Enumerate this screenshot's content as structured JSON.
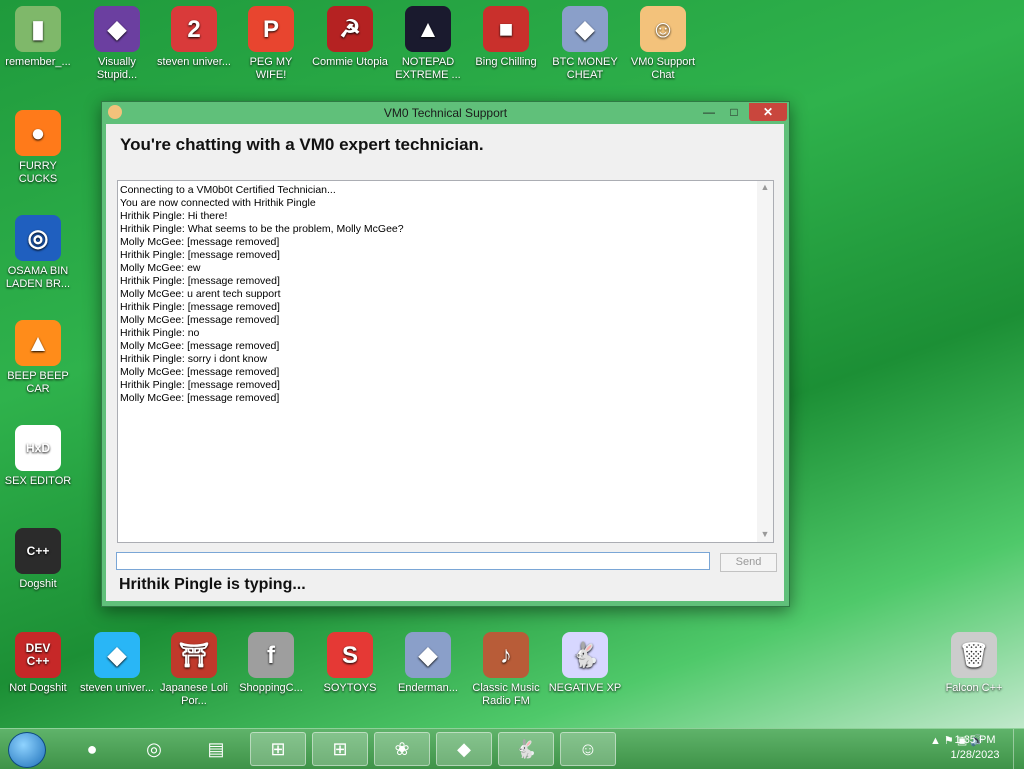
{
  "desktop_icons_top": [
    {
      "label": "remember_...",
      "color": "#7fb86a",
      "glyph": "▮"
    },
    {
      "label": "Visually Stupid...",
      "color": "#6b3fa0",
      "glyph": "◆"
    },
    {
      "label": "steven univer...",
      "color": "#d93a3a",
      "glyph": "2"
    },
    {
      "label": "PEG MY WIFE!",
      "color": "#e8452f",
      "glyph": "P"
    },
    {
      "label": "Commie Utopia",
      "color": "#b52222",
      "glyph": "☭"
    },
    {
      "label": "NOTEPAD EXTREME ...",
      "color": "#1a1a2e",
      "glyph": "▲"
    },
    {
      "label": "Bing Chilling",
      "color": "#c9302c",
      "glyph": "■"
    },
    {
      "label": "BTC MONEY CHEAT",
      "color": "#8a9fc9",
      "glyph": "◆"
    },
    {
      "label": "VM0 Support Chat",
      "color": "#f3c27b",
      "glyph": "☺"
    }
  ],
  "desktop_icons_left": [
    {
      "label": "FURRY CUCKS",
      "color": "#ff7a1a",
      "glyph": "●"
    },
    {
      "label": "OSAMA BIN LADEN BR...",
      "color": "#1f5fbf",
      "glyph": "◎"
    },
    {
      "label": "BEEP BEEP CAR",
      "color": "#ff8c1a",
      "glyph": "▲"
    },
    {
      "label": "SEX EDITOR",
      "color": "#ffffff",
      "glyph": "HxD"
    },
    {
      "label": "Dogshit",
      "color": "#2b2b2b",
      "glyph": "C++"
    }
  ],
  "desktop_icons_bottom": [
    {
      "label": "Not Dogshit",
      "color": "#c62828",
      "glyph": "DEV C++"
    },
    {
      "label": "steven univer...",
      "color": "#29b6f6",
      "glyph": "◆"
    },
    {
      "label": "Japanese Loli Por...",
      "color": "#c0392b",
      "glyph": "⛩"
    },
    {
      "label": "ShoppingC...",
      "color": "#9e9e9e",
      "glyph": "f"
    },
    {
      "label": "SOYTOYS",
      "color": "#e53935",
      "glyph": "S"
    },
    {
      "label": "Enderman...",
      "color": "#8a9fc9",
      "glyph": "◆"
    },
    {
      "label": "Classic Music Radio FM",
      "color": "#b85c38",
      "glyph": "♪"
    },
    {
      "label": "NEGATIVE XP",
      "color": "#d7d7ff",
      "glyph": "🐇"
    },
    {
      "label": "Falcon C++",
      "color": "#cccccc",
      "glyph": "🗑"
    }
  ],
  "window": {
    "title": "VM0 Technical Support",
    "heading": "You're chatting with a VM0 expert technician.",
    "log": [
      "Connecting to a VM0b0t Certified Technician...",
      "You are now connected with Hrithik Pingle",
      "Hrithik Pingle: Hi there!",
      "Hrithik Pingle: What seems to be the problem, Molly McGee?",
      "Molly McGee: [message removed]",
      "Hrithik Pingle: [message removed]",
      "Molly McGee: ew",
      "Hrithik Pingle: [message removed]",
      "Molly McGee: u arent tech support",
      "Hrithik Pingle: [message removed]",
      "Molly McGee: [message removed]",
      "Hrithik Pingle: no",
      "Molly McGee: [message removed]",
      "Hrithik Pingle: sorry i dont know",
      "Molly McGee: [message removed]",
      "Hrithik Pingle: [message removed]",
      "Molly McGee: [message removed]"
    ],
    "input_value": "",
    "send_label": "Send",
    "typing_status": "Hrithik Pingle is typing..."
  },
  "taskbar": {
    "items": [
      {
        "name": "firefox",
        "glyph": "●",
        "active": false
      },
      {
        "name": "obama-app",
        "glyph": "◎",
        "active": false
      },
      {
        "name": "explorer",
        "glyph": "▤",
        "active": false
      },
      {
        "name": "network-app-1",
        "glyph": "⊞",
        "active": true
      },
      {
        "name": "network-app-2",
        "glyph": "⊞",
        "active": true
      },
      {
        "name": "green-app",
        "glyph": "❀",
        "active": true
      },
      {
        "name": "visual-studio",
        "glyph": "◆",
        "active": true
      },
      {
        "name": "rabbit-app",
        "glyph": "🐇",
        "active": true
      },
      {
        "name": "support-chat",
        "glyph": "☺",
        "active": true
      }
    ],
    "time": "1:35 PM",
    "date": "1/28/2023"
  }
}
